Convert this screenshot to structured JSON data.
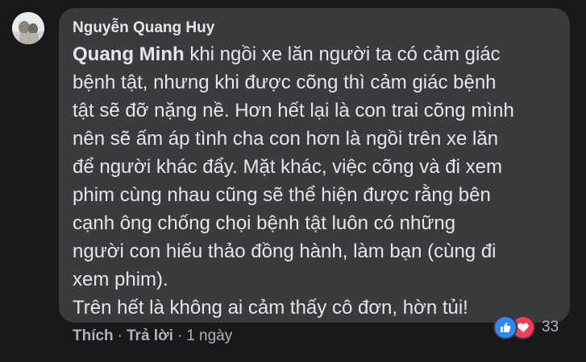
{
  "comment": {
    "author": "Nguyễn Quang Huy",
    "mention": "Quang Minh",
    "lines": [
      " khi ngồi xe lăn người ta có cảm giác",
      "bệnh tật, nhưng khi được cõng thì cảm giác bệnh",
      "tật sẽ đỡ nặng nề. Hơn hết lại là con trai cõng mình",
      "nên sẽ ấm áp tình cha con hơn là ngồi trên xe lăn",
      "để người khác đẩy. Mặt khác, việc cõng và đi xem",
      "phim cùng nhau cũng sẽ thể hiện được rằng bên",
      "cạnh ông chống chọi bệnh tật luôn có những",
      "người con hiếu thảo đồng hành, làm bạn (cùng đi",
      "xem phim).",
      "Trên hết là không ai cảm thấy cô đơn, hờn tủi!"
    ]
  },
  "actions": {
    "like": "Thích",
    "reply": "Trả lời",
    "separator": "·",
    "time": "1 ngày"
  },
  "reactions": {
    "icons": [
      "like-icon",
      "love-icon"
    ],
    "count": "33"
  },
  "colors": {
    "page_bg": "#18191a",
    "bubble_bg": "#3a3b3c",
    "text_primary": "#e4e6eb",
    "text_secondary": "#b0b3b8",
    "like_blue": "#2d88ff",
    "love_red": "#f33e58"
  }
}
